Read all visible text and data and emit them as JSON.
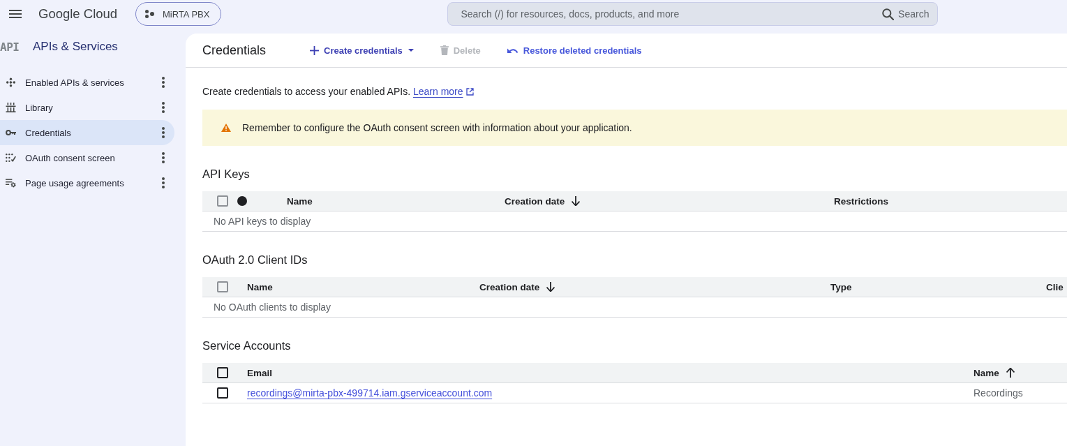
{
  "top_bar": {
    "product": "Google Cloud",
    "project": "MiRTA PBX",
    "search": {
      "placeholder": "Search (/) for resources, docs, products, and more",
      "button": "Search"
    }
  },
  "sidebar": {
    "logo": "API",
    "title": "APIs & Services",
    "items": [
      {
        "label": "Enabled APIs & services",
        "selected": false
      },
      {
        "label": "Library",
        "selected": false
      },
      {
        "label": "Credentials",
        "selected": true
      },
      {
        "label": "OAuth consent screen",
        "selected": false
      },
      {
        "label": "Page usage agreements",
        "selected": false
      }
    ]
  },
  "page": {
    "title": "Credentials",
    "actions": [
      {
        "kind": "create",
        "label": "Create credentials",
        "disabled": false
      },
      {
        "kind": "delete",
        "label": "Delete",
        "disabled": true
      },
      {
        "kind": "restore",
        "label": "Restore deleted credentials",
        "disabled": false
      }
    ],
    "intro": {
      "text": "Create credentials to access your enabled APIs.",
      "link": "Learn more"
    },
    "banner": {
      "text": "Remember to configure the OAuth consent screen with information about your application."
    },
    "sections": [
      {
        "title": "API Keys",
        "table": {
          "columns": [
            {
              "kind": "checkbox",
              "checked": false,
              "disabled": true
            },
            {
              "kind": "status"
            },
            {
              "kind": "label",
              "label": "Name"
            },
            {
              "kind": "label",
              "label": "Creation date",
              "sorted": true,
              "descending": true
            },
            {
              "kind": "label",
              "label": "Restrictions"
            }
          ],
          "empty_message": "No API keys to display"
        }
      },
      {
        "title": "OAuth 2.0 Client IDs",
        "table": {
          "columns": [
            {
              "kind": "checkbox",
              "checked": false,
              "disabled": true
            },
            {
              "kind": "label",
              "label": "Name"
            },
            {
              "kind": "label",
              "label": "Creation date",
              "sorted": true,
              "descending": true
            },
            {
              "kind": "label",
              "label": "Type"
            },
            {
              "kind": "label",
              "label": "Clie"
            }
          ],
          "empty_message": "No OAuth clients to display"
        }
      },
      {
        "title": "Service Accounts",
        "table": {
          "columns": [
            {
              "kind": "checkbox",
              "checked": false,
              "disabled": false
            },
            {
              "kind": "label",
              "label": "Email"
            },
            {
              "kind": "label",
              "label": "Name",
              "sorted": true,
              "descending": false
            }
          ],
          "rows": [
            {
              "cells": [
                {
                  "kind": "checkbox",
                  "checked": false,
                  "disabled": false
                },
                {
                  "kind": "link",
                  "text": "recordings@mirta-pbx-499714.iam.gserviceaccount.com"
                },
                {
                  "kind": "text",
                  "text": "Recordings"
                }
              ]
            }
          ]
        }
      }
    ]
  }
}
